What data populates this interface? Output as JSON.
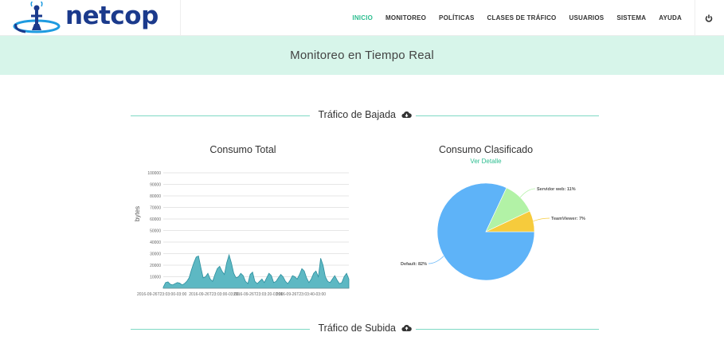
{
  "brand": {
    "name": "netcop"
  },
  "nav": {
    "items": [
      "INICIO",
      "MONITOREO",
      "POLÍTICAS",
      "CLASES DE TRÁFICO",
      "USUARIOS",
      "SISTEMA",
      "AYUDA"
    ],
    "active": "INICIO"
  },
  "page": {
    "title": "Monitoreo en Tiempo Real"
  },
  "sections": {
    "download": "Tráfico de Bajada",
    "upload": "Tráfico de Subida"
  },
  "total_chart": {
    "title": "Consumo Total",
    "x_tick_labels": [
      "2016-09-26T23:03:00-03:00",
      "2016-09-26T23:03:20-03:00",
      "2016-09-26T23:03:40-03:00"
    ]
  },
  "classified_chart": {
    "title": "Consumo Clasificado",
    "detail_link": "Ver Detalle"
  },
  "colors": {
    "accent": "#2bbd8f",
    "banner": "#d7f5ea",
    "area_fill": "#5db8c3",
    "area_stroke": "#2d8f9e",
    "pie_default": "#5eb3f8",
    "pie_web": "#b2f2a6",
    "pie_teamviewer": "#f6cb3c"
  },
  "chart_data": [
    {
      "type": "area",
      "title": "Consumo Total",
      "xlabel": "",
      "ylabel": "bytes",
      "ylim": [
        0,
        100000
      ],
      "yticks": [
        10000,
        20000,
        30000,
        40000,
        50000,
        60000,
        70000,
        80000,
        90000,
        100000
      ],
      "x": [
        0,
        1,
        2,
        3,
        4,
        5,
        6,
        7,
        8,
        9,
        10,
        11,
        12,
        13,
        14,
        15,
        16,
        17,
        18,
        19,
        20,
        21,
        22,
        23,
        24,
        25,
        26,
        27,
        28,
        29,
        30,
        31,
        32,
        33,
        34,
        35,
        36,
        37,
        38,
        39,
        40,
        41,
        42,
        43,
        44,
        45,
        46,
        47,
        48,
        49,
        50,
        51,
        52,
        53,
        54,
        55,
        56,
        57,
        58,
        59,
        60,
        61,
        62,
        63,
        64,
        65,
        66,
        67,
        68,
        69,
        70,
        71,
        72,
        73,
        74,
        75,
        76,
        77,
        78,
        79
      ],
      "values": [
        1000,
        5000,
        5500,
        3500,
        3000,
        4000,
        5000,
        4500,
        3000,
        4000,
        6000,
        9000,
        16000,
        22000,
        27000,
        28000,
        18000,
        9000,
        10000,
        13000,
        8000,
        6000,
        12000,
        17000,
        19000,
        15000,
        12000,
        22000,
        29000,
        22000,
        13000,
        9000,
        10000,
        13000,
        11000,
        6000,
        4000,
        12000,
        14000,
        6000,
        4000,
        6000,
        8000,
        5000,
        9000,
        13000,
        11000,
        5000,
        6000,
        9000,
        12000,
        10000,
        6000,
        4000,
        7000,
        11000,
        10000,
        8000,
        12000,
        17000,
        15000,
        9000,
        5000,
        8000,
        13000,
        15000,
        10000,
        26000,
        20000,
        10000,
        6000,
        5000,
        8000,
        11000,
        7000,
        4000,
        5000,
        10000,
        13000,
        8000
      ],
      "grid": true,
      "legend": "none"
    },
    {
      "type": "pie",
      "title": "Consumo Clasificado",
      "slices": [
        {
          "label": "Default",
          "value": 82
        },
        {
          "label": "Servidor web",
          "value": 11
        },
        {
          "label": "TeamViewer",
          "value": 7
        }
      ],
      "label_format": "{label}: {value}%",
      "legend": "none"
    }
  ]
}
